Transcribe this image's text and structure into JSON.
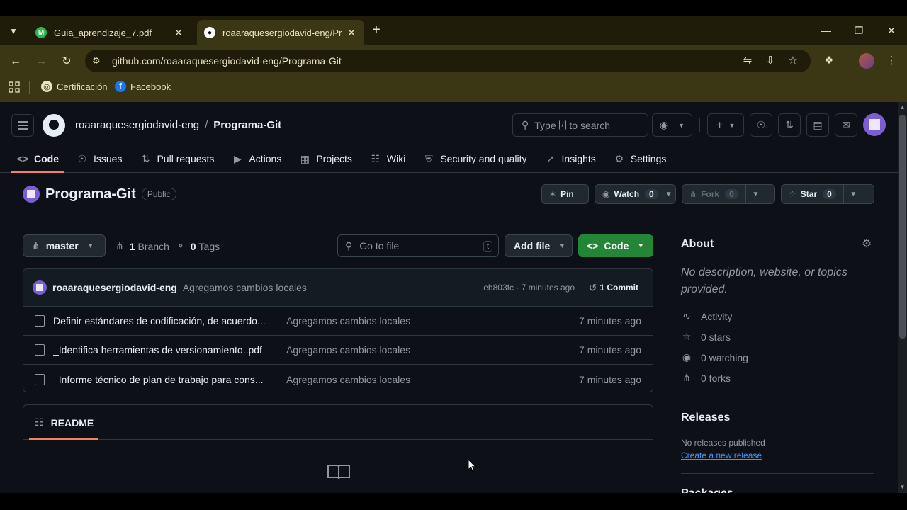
{
  "browser": {
    "tabs": [
      {
        "title": "Guia_aprendizaje_7.pdf",
        "active": false
      },
      {
        "title": "roaaraquesergiodavid-eng/Pro",
        "active": true
      }
    ],
    "url": "github.com/roaaraquesergiodavid-eng/Programa-Git",
    "bookmarks": [
      {
        "label": "Certificación"
      },
      {
        "label": "Facebook"
      }
    ]
  },
  "header": {
    "owner": "roaaraquesergiodavid-eng",
    "separator": "/",
    "repo": "Programa-Git",
    "search_pre": "Type",
    "search_key": "/",
    "search_post": "to search"
  },
  "reponav": [
    {
      "label": "Code",
      "icon": "code-icon"
    },
    {
      "label": "Issues",
      "icon": "issue-icon"
    },
    {
      "label": "Pull requests",
      "icon": "pull-request-icon"
    },
    {
      "label": "Actions",
      "icon": "play-icon"
    },
    {
      "label": "Projects",
      "icon": "table-icon"
    },
    {
      "label": "Wiki",
      "icon": "book-icon"
    },
    {
      "label": "Security and quality",
      "icon": "shield-icon"
    },
    {
      "label": "Insights",
      "icon": "graph-icon"
    },
    {
      "label": "Settings",
      "icon": "gear-icon"
    }
  ],
  "repo": {
    "name": "Programa-Git",
    "visibility": "Public",
    "pin_label": "Pin",
    "watch_label": "Watch",
    "watch_count": "0",
    "fork_label": "Fork",
    "fork_count": "0",
    "star_label": "Star",
    "star_count": "0"
  },
  "toolbar": {
    "branch": "master",
    "branch_count": "1",
    "branch_label": "Branch",
    "tag_count": "0",
    "tag_label": "Tags",
    "gofile_placeholder": "Go to file",
    "gofile_key": "t",
    "add_file": "Add file",
    "code": "Code"
  },
  "commit": {
    "author": "roaaraquesergiodavid-eng",
    "message": "Agregamos cambios locales",
    "hash_time": "eb803fc · 7 minutes ago",
    "count": "1 Commit"
  },
  "files": [
    {
      "name": "Definir estándares de codificación, de acuerdo...",
      "message": "Agregamos cambios locales",
      "time": "7 minutes ago"
    },
    {
      "name": "_Identifica herramientas de versionamiento..pdf",
      "message": "Agregamos cambios locales",
      "time": "7 minutes ago"
    },
    {
      "name": "_Informe técnico de plan de trabajo para cons...",
      "message": "Agregamos cambios locales",
      "time": "7 minutes ago"
    }
  ],
  "readme": {
    "label": "README"
  },
  "about": {
    "title": "About",
    "description": "No description, website, or topics provided.",
    "activity": "Activity",
    "stars": "0 stars",
    "watching": "0 watching",
    "forks": "0 forks"
  },
  "releases": {
    "title": "Releases",
    "none": "No releases published",
    "create": "Create a new release"
  },
  "packages": {
    "title": "Packages"
  },
  "colors": {
    "accent_green": "#238636",
    "underline": "#f78166",
    "link": "#4493f8",
    "bg": "#0d1117"
  }
}
